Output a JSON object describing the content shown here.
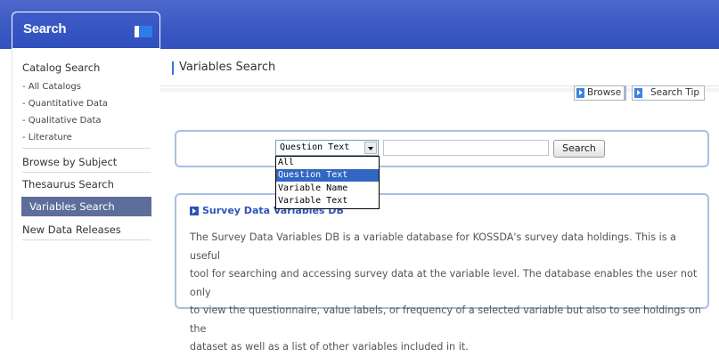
{
  "sidebar": {
    "title": "Search",
    "catalog_search": "Catalog Search",
    "sub_items": [
      "- All Catalogs",
      "- Quantitative Data",
      "- Qualitative Data",
      "- Literature"
    ],
    "items": [
      {
        "label": "Browse by Subject"
      },
      {
        "label": "Thesaurus Search"
      },
      {
        "label": "Variables Search",
        "active": true
      },
      {
        "label": "New Data Releases"
      }
    ]
  },
  "main": {
    "page_title": "Variables Search",
    "browse_label": "Browse",
    "search_tip_label": "Search Tip",
    "search": {
      "selected": "Question Text",
      "input_value": "",
      "button_label": "Search",
      "options": [
        "All",
        "Question Text",
        "Variable Name",
        "Variable Text"
      ]
    },
    "info": {
      "title": "Survey Data Variables DB",
      "lines": [
        "The Survey Data Variables DB is a variable database for KOSSDA's survey data holdings. This is a useful",
        "tool for searching and accessing survey data at the variable level. The database enables the user not only",
        "to view the questionnaire, value labels, or frequency of a selected variable but also to see holdings on the",
        "dataset as well as a list of other variables included in it."
      ]
    }
  },
  "colors": {
    "header_blue": "#3a58c2",
    "active_item": "#5c6e99",
    "panel_border": "#a8bfe3",
    "dropdown_highlight": "#3166c3"
  }
}
